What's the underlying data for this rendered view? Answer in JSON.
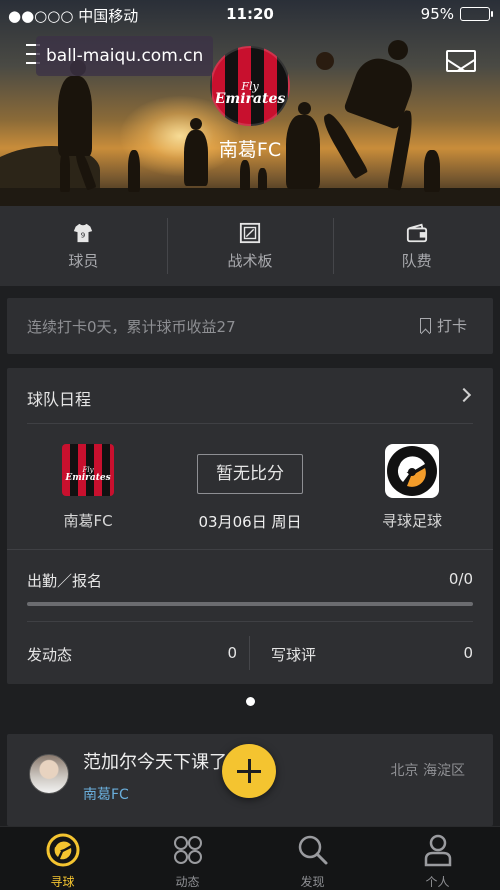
{
  "status_bar": {
    "carrier": "●●○○○ 中国移动",
    "time": "11:20",
    "battery": "95%"
  },
  "watermark": "ball-maiqu.com.cn",
  "team": {
    "name": "南葛FC",
    "logo_text_small": "Fly",
    "logo_text_big": "Emirates"
  },
  "quick_nav": [
    {
      "label": "球员",
      "icon": "jersey-icon"
    },
    {
      "label": "战术板",
      "icon": "tactics-board-icon"
    },
    {
      "label": "队费",
      "icon": "wallet-icon"
    }
  ],
  "checkin": {
    "text": "连续打卡0天，累计球币收益27",
    "button_label": "打卡"
  },
  "schedule": {
    "title": "球队日程",
    "home_team": "南葛FC",
    "away_team": "寻球足球",
    "score_label": "暂无比分",
    "date": "03月06日 周日",
    "attendance_label": "出勤／报名",
    "attendance_count": "0/0",
    "attendance_fraction": 0,
    "post_label": "发动态",
    "post_count": "0",
    "review_label": "写球评",
    "review_count": "0"
  },
  "feed": {
    "title": "范加尔今天下课了没有",
    "team": "南葛FC",
    "location": "北京 海淀区"
  },
  "tabbar": [
    {
      "label": "寻球",
      "icon": "ball-icon",
      "active": true
    },
    {
      "label": "动态",
      "icon": "grid-icon",
      "active": false
    },
    {
      "label": "发现",
      "icon": "search-icon",
      "active": false
    },
    {
      "label": "个人",
      "icon": "person-icon",
      "active": false
    }
  ],
  "colors": {
    "accent": "#f4c430",
    "background": "#1e1f21",
    "card": "#2e2f32",
    "link": "#6aaedb"
  }
}
